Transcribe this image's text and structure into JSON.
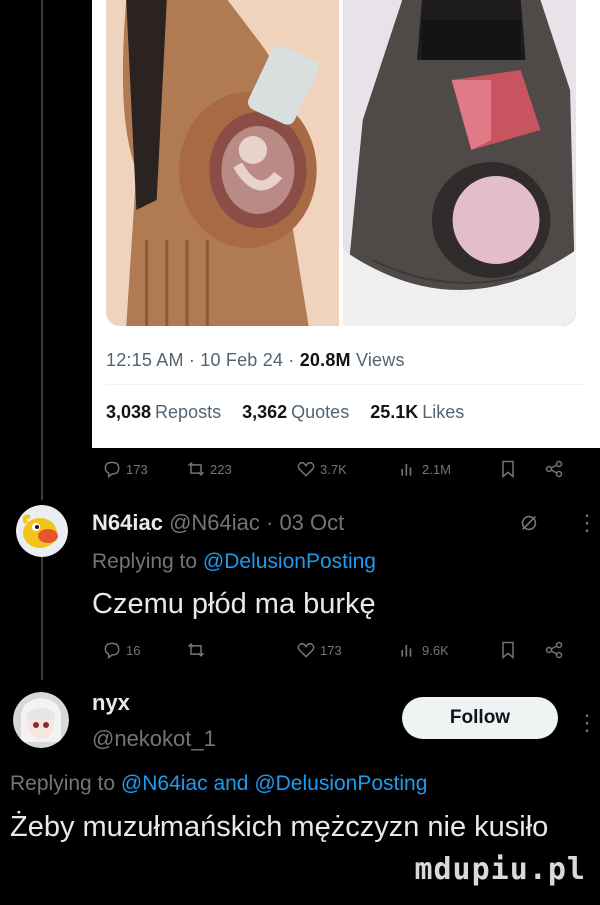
{
  "main_tweet": {
    "timestamp": "12:15 AM · 10 Feb 24 ·",
    "views_count": "20.8M",
    "views_label": "Views",
    "reposts_count": "3,038",
    "reposts_label": "Reposts",
    "quotes_count": "3,362",
    "quotes_label": "Quotes",
    "likes_count": "25.1K",
    "likes_label": "Likes",
    "actions": {
      "replies": "173",
      "reposts": "223",
      "likes": "3.7K",
      "views": "2.1M"
    }
  },
  "reply_1": {
    "name": "N64iac",
    "handle": "@N64iac · 03 Oct",
    "replying_prefix": "Replying to",
    "replying_to": "@DelusionPosting",
    "text": "Czemu płód ma burkę",
    "actions": {
      "replies": "16",
      "reposts": "",
      "likes": "173",
      "views": "9.6K"
    }
  },
  "reply_2": {
    "name": "nyx",
    "handle": "@nekokot_1",
    "follow_label": "Follow",
    "replying_prefix": "Replying to",
    "replying_to_1": "@N64iac",
    "replying_and": "and",
    "replying_to_2": "@DelusionPosting",
    "text": "Żeby muzułmańskich mężczyzn nie kusiło"
  },
  "watermark": "mdupiu.pl",
  "colors": {
    "link": "#1d9bf0",
    "muted": "#71767b",
    "background": "#000000"
  },
  "icons": [
    "reply-icon",
    "repost-icon",
    "like-icon",
    "views-icon",
    "bookmark-icon",
    "share-icon",
    "grok-icon",
    "more-icon"
  ]
}
